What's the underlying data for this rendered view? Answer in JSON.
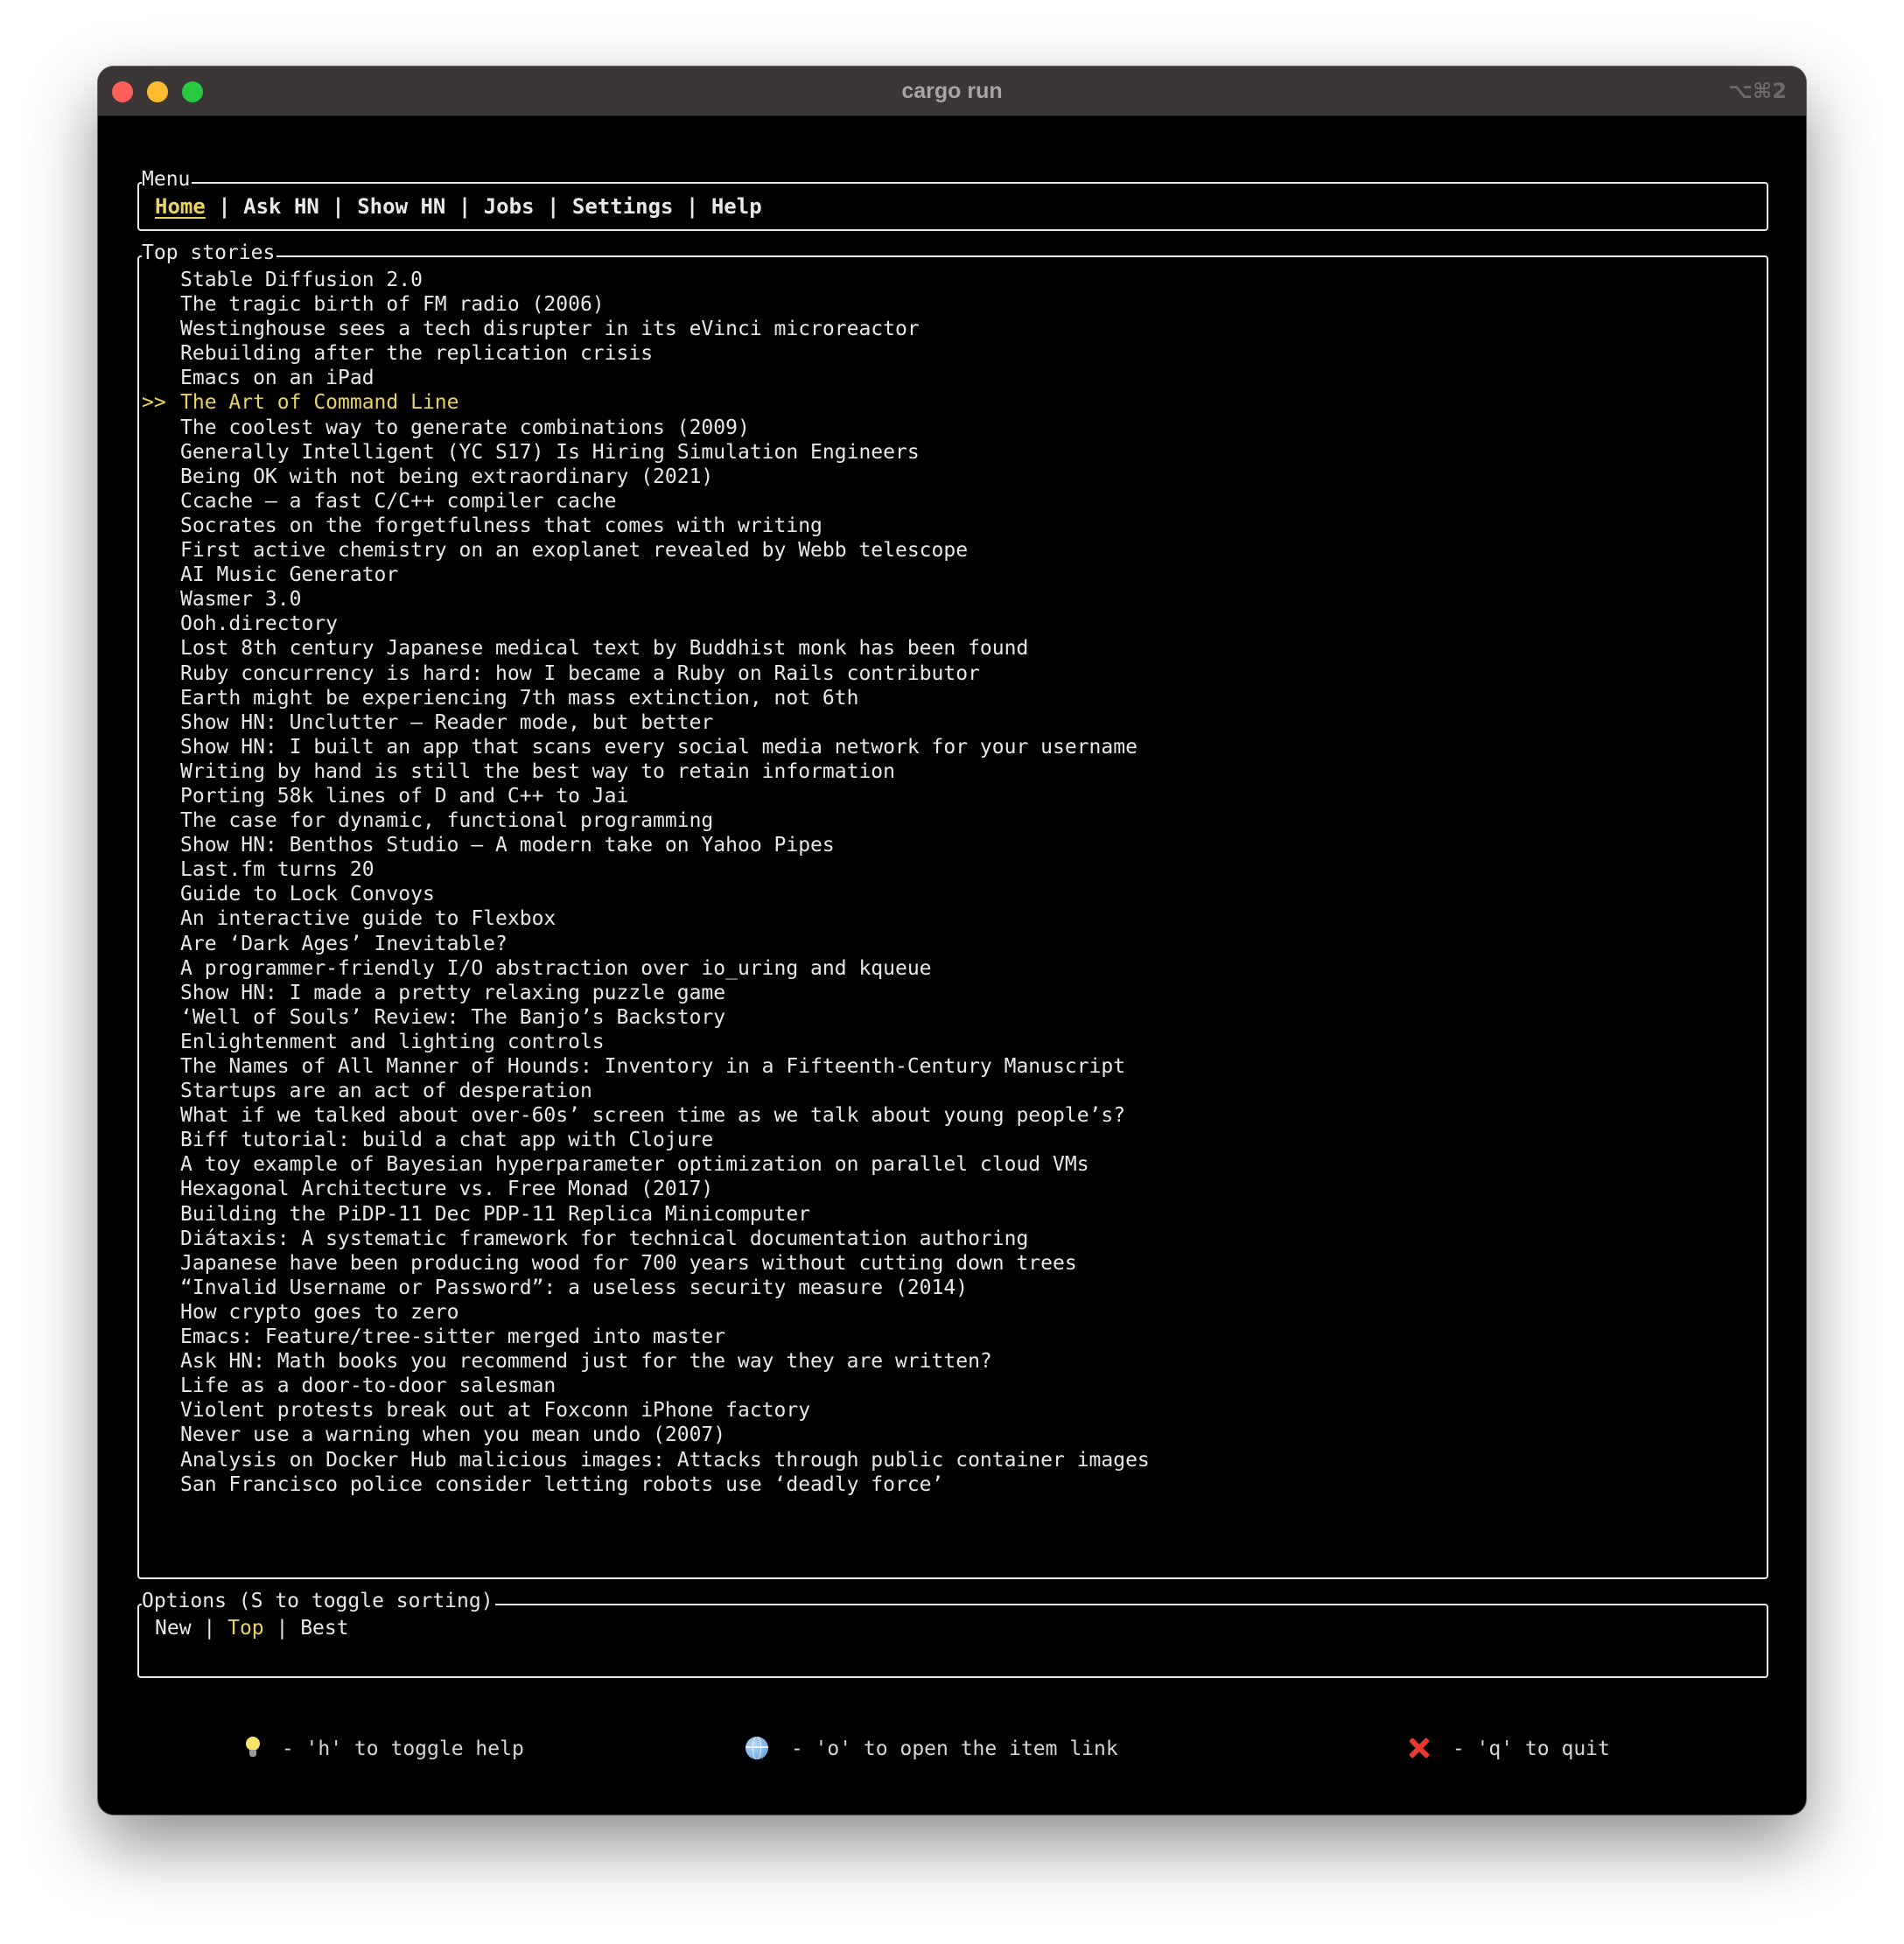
{
  "window": {
    "title": "cargo run",
    "shortcut": "⌥⌘2"
  },
  "menu": {
    "panel_title": "Menu",
    "items": [
      {
        "label": "Home",
        "active": true
      },
      {
        "label": "Ask HN",
        "active": false
      },
      {
        "label": "Show HN",
        "active": false
      },
      {
        "label": "Jobs",
        "active": false
      },
      {
        "label": "Settings",
        "active": false
      },
      {
        "label": "Help",
        "active": false
      }
    ],
    "separator": "|"
  },
  "stories": {
    "panel_title": "Top stories",
    "selected_marker": ">>",
    "selected_index": 5,
    "items": [
      "Stable Diffusion 2.0",
      "The tragic birth of FM radio (2006)",
      "Westinghouse sees a tech disrupter in its eVinci microreactor",
      "Rebuilding after the replication crisis",
      "Emacs on an iPad",
      "The Art of Command Line",
      "The coolest way to generate combinations (2009)",
      "Generally Intelligent (YC S17) Is Hiring Simulation Engineers",
      "Being OK with not being extraordinary (2021)",
      "Ccache – a fast C/C++ compiler cache",
      "Socrates on the forgetfulness that comes with writing",
      "First active chemistry on an exoplanet revealed by Webb telescope",
      "AI Music Generator",
      "Wasmer 3.0",
      "Ooh.directory",
      "Lost 8th century Japanese medical text by Buddhist monk has been found",
      "Ruby concurrency is hard: how I became a Ruby on Rails contributor",
      "Earth might be experiencing 7th mass extinction, not 6th",
      "Show HN: Unclutter – Reader mode, but better",
      "Show HN: I built an app that scans every social media network for your username",
      "Writing by hand is still the best way to retain information",
      "Porting 58k lines of D and C++ to Jai",
      "The case for dynamic, functional programming",
      "Show HN: Benthos Studio – A modern take on Yahoo Pipes",
      "Last.fm turns 20",
      "Guide to Lock Convoys",
      "An interactive guide to Flexbox",
      "Are ‘Dark Ages’ Inevitable?",
      "A programmer-friendly I/O abstraction over io_uring and kqueue",
      "Show HN: I made a pretty relaxing puzzle game",
      "‘Well of Souls’ Review: The Banjo’s Backstory",
      "Enlightenment and lighting controls",
      "The Names of All Manner of Hounds: Inventory in a Fifteenth-Century Manuscript",
      "Startups are an act of desperation",
      "What if we talked about over-60s’ screen time as we talk about young people’s?",
      "Biff tutorial: build a chat app with Clojure",
      "A toy example of Bayesian hyperparameter optimization on parallel cloud VMs",
      "Hexagonal Architecture vs. Free Monad (2017)",
      "Building the PiDP-11 Dec PDP-11 Replica Minicomputer",
      "Diátaxis: A systematic framework for technical documentation authoring",
      "Japanese have been producing wood for 700 years without cutting down trees",
      "“Invalid Username or Password”: a useless security measure (2014)",
      "How crypto goes to zero",
      "Emacs: Feature/tree-sitter merged into master",
      "Ask HN: Math books you recommend just for the way they are written?",
      "Life as a door-to-door salesman",
      "Violent protests break out at Foxconn iPhone factory",
      "Never use a warning when you mean undo (2007)",
      "Analysis on Docker Hub malicious images: Attacks through public container images",
      "San Francisco police consider letting robots use ‘deadly force’"
    ]
  },
  "options": {
    "panel_title": "Options (S to toggle sorting)",
    "items": [
      {
        "label": "New",
        "active": false
      },
      {
        "label": "Top",
        "active": true
      },
      {
        "label": "Best",
        "active": false
      }
    ],
    "separator": "|"
  },
  "footer": {
    "help_hint": " - 'h' to toggle help",
    "open_hint": " - 'o' to open the item link",
    "quit_hint": " - 'q' to quit",
    "icons": {
      "help": "lightbulb-icon",
      "open": "globe-icon",
      "quit": "cross-icon"
    }
  },
  "colors": {
    "accent": "#e9d463",
    "text": "#e8e8e8",
    "background": "#000000",
    "titlebar": "#3a3636"
  }
}
